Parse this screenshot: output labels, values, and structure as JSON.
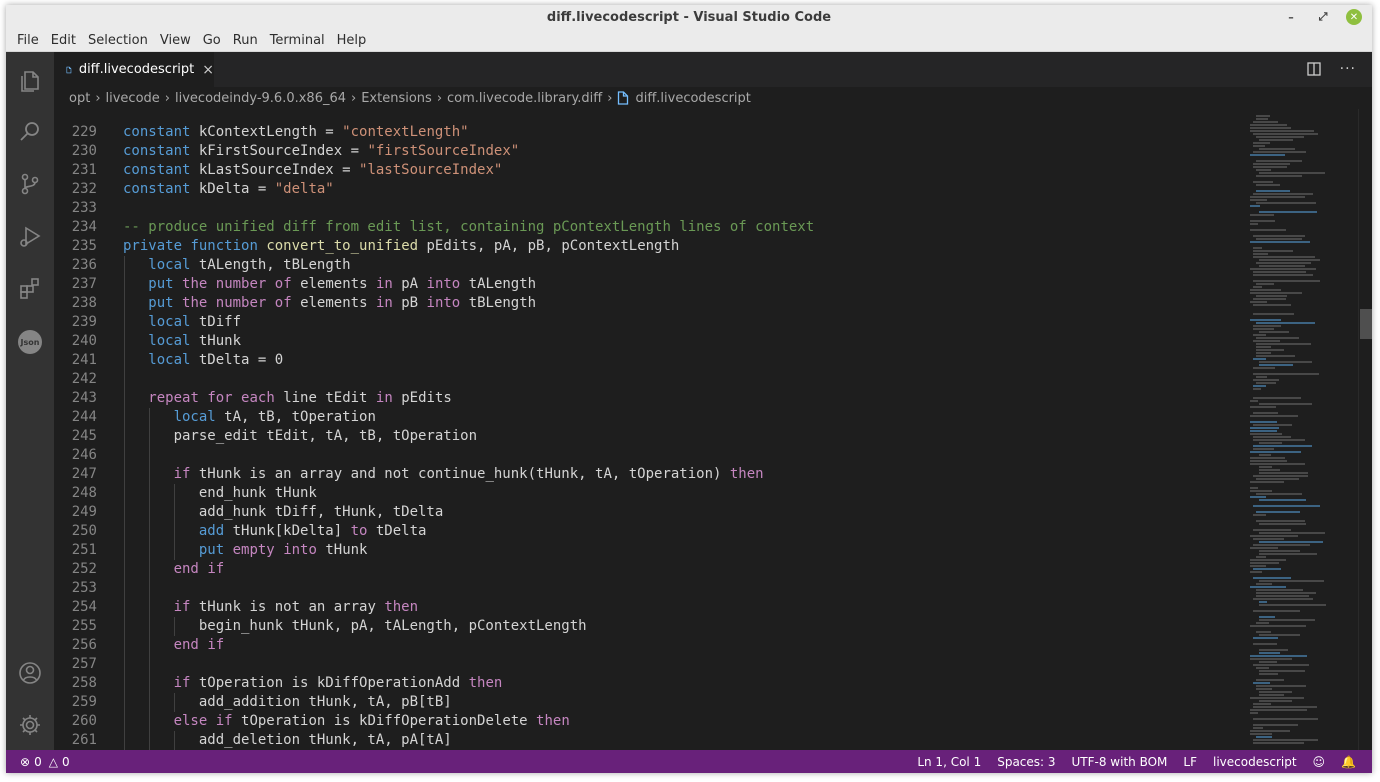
{
  "window": {
    "title": "diff.livecodescript - Visual Studio Code",
    "controls": [
      "minimize",
      "maximize",
      "close"
    ]
  },
  "menu": [
    "File",
    "Edit",
    "Selection",
    "View",
    "Go",
    "Run",
    "Terminal",
    "Help"
  ],
  "activity_bar": {
    "items": [
      "explorer-icon",
      "search-icon",
      "source-control-icon",
      "run-debug-icon",
      "extensions-icon",
      "json-icon"
    ],
    "json_badge": "Json",
    "bottom_items": [
      "account-icon",
      "settings-gear-icon"
    ]
  },
  "tab": {
    "label": "diff.livecodescript",
    "close": "×"
  },
  "tab_actions": [
    "split-editor-icon",
    "more-actions-icon"
  ],
  "breadcrumb": [
    "opt",
    "livecode",
    "livecodeindy-9.6.0.x86_64",
    "Extensions",
    "com.livecode.library.diff",
    "diff.livecodescript"
  ],
  "editor": {
    "lines": [
      {
        "n": "229",
        "t": "constant kContextLength = \"contextLength\""
      },
      {
        "n": "230",
        "t": "constant kFirstSourceIndex = \"firstSourceIndex\""
      },
      {
        "n": "231",
        "t": "constant kLastSourceIndex = \"lastSourceIndex\""
      },
      {
        "n": "232",
        "t": "constant kDelta = \"delta\""
      },
      {
        "n": "233",
        "t": ""
      },
      {
        "n": "234",
        "t": "-- produce unified diff from edit list, containing pContextLength lines of context"
      },
      {
        "n": "235",
        "t": "private function convert_to_unified pEdits, pA, pB, pContextLength"
      },
      {
        "n": "236",
        "t": "   local tALength, tBLength"
      },
      {
        "n": "237",
        "t": "   put the number of elements in pA into tALength"
      },
      {
        "n": "238",
        "t": "   put the number of elements in pB into tBLength"
      },
      {
        "n": "239",
        "t": "   local tDiff"
      },
      {
        "n": "240",
        "t": "   local tHunk"
      },
      {
        "n": "241",
        "t": "   local tDelta = 0"
      },
      {
        "n": "242",
        "t": ""
      },
      {
        "n": "243",
        "t": "   repeat for each line tEdit in pEdits"
      },
      {
        "n": "244",
        "t": "      local tA, tB, tOperation"
      },
      {
        "n": "245",
        "t": "      parse_edit tEdit, tA, tB, tOperation"
      },
      {
        "n": "246",
        "t": ""
      },
      {
        "n": "247",
        "t": "      if tHunk is an array and not continue_hunk(tHunk, tA, tOperation) then"
      },
      {
        "n": "248",
        "t": "         end_hunk tHunk"
      },
      {
        "n": "249",
        "t": "         add_hunk tDiff, tHunk, tDelta"
      },
      {
        "n": "250",
        "t": "         add tHunk[kDelta] to tDelta"
      },
      {
        "n": "251",
        "t": "         put empty into tHunk"
      },
      {
        "n": "252",
        "t": "      end if"
      },
      {
        "n": "253",
        "t": ""
      },
      {
        "n": "254",
        "t": "      if tHunk is not an array then"
      },
      {
        "n": "255",
        "t": "         begin_hunk tHunk, pA, tALength, pContextLength"
      },
      {
        "n": "256",
        "t": "      end if"
      },
      {
        "n": "257",
        "t": ""
      },
      {
        "n": "258",
        "t": "      if tOperation is kDiffOperationAdd then"
      },
      {
        "n": "259",
        "t": "         add_addition tHunk, tA, pB[tB]"
      },
      {
        "n": "260",
        "t": "      else if tOperation is kDiffOperationDelete then"
      },
      {
        "n": "261",
        "t": "         add_deletion tHunk, tA, pA[tA]"
      }
    ]
  },
  "status_bar": {
    "errors": "0",
    "warnings": "0",
    "position": "Ln 1, Col 1",
    "spaces": "Spaces: 3",
    "encoding": "UTF-8 with BOM",
    "eol": "LF",
    "language": "livecodescript"
  },
  "colors": {
    "status_bar": "#68217a",
    "editor_bg": "#1e1e1e",
    "activity_bar": "#333333",
    "keyword": "#569cd6",
    "control": "#c586c0",
    "string": "#ce9178",
    "comment": "#6a9955"
  }
}
